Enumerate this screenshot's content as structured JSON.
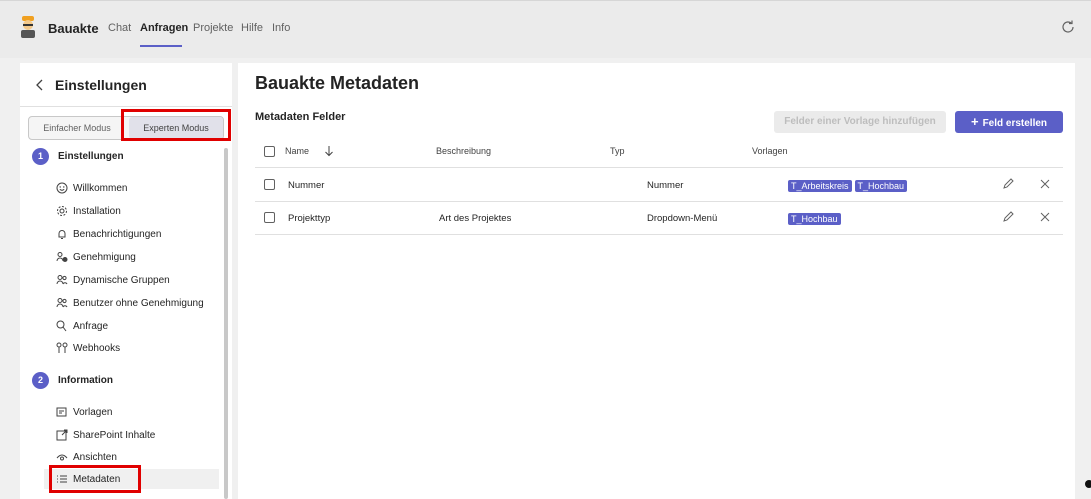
{
  "app": {
    "name": "Bauakte"
  },
  "nav": {
    "tabs": [
      {
        "label": "Chat"
      },
      {
        "label": "Anfragen"
      },
      {
        "label": "Projekte"
      },
      {
        "label": "Hilfe"
      },
      {
        "label": "Info"
      }
    ],
    "active": "Anfragen"
  },
  "sidebar": {
    "title": "Einstellungen",
    "mode": {
      "simple": "Einfacher Modus",
      "expert": "Experten Modus",
      "selected": "Experten Modus"
    },
    "sections": [
      {
        "number": "1",
        "title": "Einstellungen",
        "items": [
          {
            "label": "Willkommen",
            "icon": "smiley-icon"
          },
          {
            "label": "Installation",
            "icon": "gear-icon"
          },
          {
            "label": "Benachrichtigungen",
            "icon": "bell-icon"
          },
          {
            "label": "Genehmigung",
            "icon": "people-check-icon"
          },
          {
            "label": "Dynamische Gruppen",
            "icon": "people-icon"
          },
          {
            "label": "Benutzer ohne Genehmigung",
            "icon": "people-icon"
          },
          {
            "label": "Anfrage",
            "icon": "chat-question-icon"
          },
          {
            "label": "Webhooks",
            "icon": "webhooks-icon"
          }
        ]
      },
      {
        "number": "2",
        "title": "Information",
        "items": [
          {
            "label": "Vorlagen",
            "icon": "template-icon"
          },
          {
            "label": "SharePoint Inhalte",
            "icon": "share-icon"
          },
          {
            "label": "Ansichten",
            "icon": "eye-icon"
          },
          {
            "label": "Metadaten",
            "icon": "list-icon"
          }
        ]
      }
    ],
    "selected_item": "Metadaten"
  },
  "main": {
    "title": "Bauakte Metadaten",
    "subtitle": "Metadaten Felder",
    "btn_template": "Felder einer Vorlage hinzufügen",
    "btn_create": "Feld erstellen",
    "columns": {
      "name": "Name",
      "description": "Beschreibung",
      "type": "Typ",
      "templates": "Vorlagen"
    },
    "rows": [
      {
        "name": "Nummer",
        "description": "",
        "type": "Nummer",
        "templates": [
          "T_Arbeitskreis",
          "T_Hochbau"
        ]
      },
      {
        "name": "Projekttyp",
        "description": "Art des Projektes",
        "type": "Dropdown-Menü",
        "templates": [
          "T_Hochbau"
        ]
      }
    ]
  },
  "colors": {
    "accent": "#5b5fc7",
    "highlight": "#e00000"
  }
}
